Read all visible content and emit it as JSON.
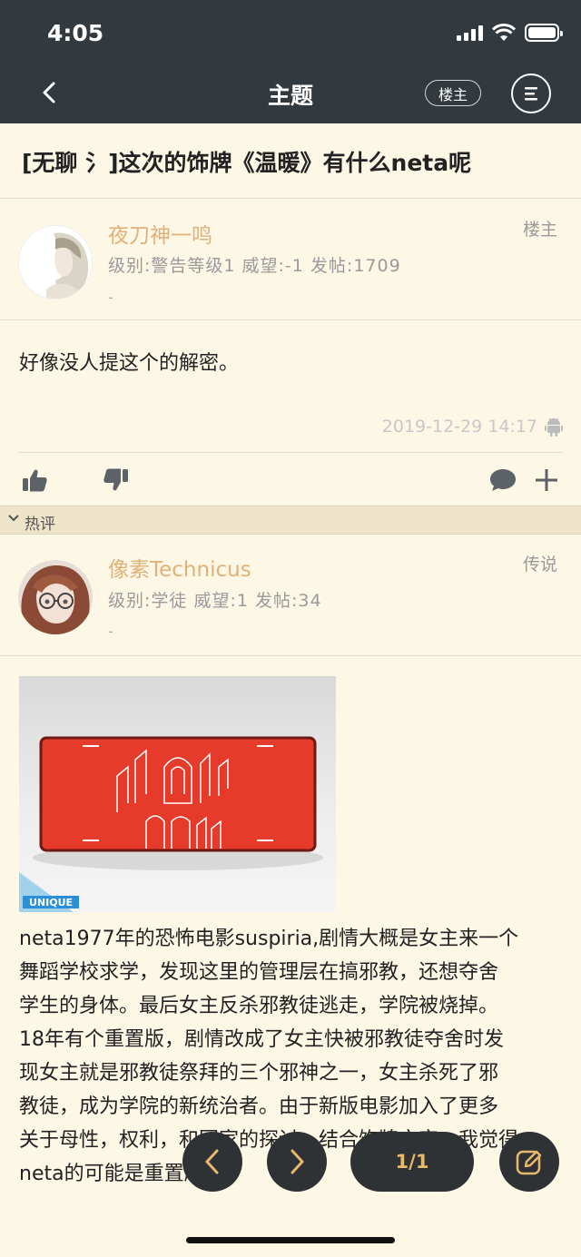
{
  "status_bar": {
    "time": "4:05"
  },
  "nav": {
    "title": "主题",
    "op_label": "楼主"
  },
  "thread": {
    "title": "[无聊 氵]这次的饰牌《温暖》有什么neta呢"
  },
  "op_post": {
    "user": {
      "name": "夜刀神一鸣",
      "level": "级别:警告等级1  威望:-1  发帖:1709",
      "dash": "-",
      "badge": "楼主"
    },
    "body": "好像没人提这个的解密。",
    "time": "2019-12-29 14:17"
  },
  "hot_section": {
    "label": "热评"
  },
  "reply": {
    "user": {
      "name": "像素Technicus",
      "level": "级别:学徒  威望:1  发帖:34",
      "dash": "-",
      "badge": "传说"
    },
    "image_watermark": "UNIQUE",
    "body_lines": [
      "neta1977年的恐怖电影suspiria,剧情大概是女主来一个",
      "舞蹈学校求学，发现这里的管理层在搞邪教，还想夺舍",
      "学生的身体。最后女主反杀邪教徒逃走，学院被烧掉。",
      "18年有个重置版，剧情改成了女主快被邪教徒夺舍时发",
      "现女主就是邪教徒祭拜的三个邪神之一，女主杀死了邪",
      "教徒，成为学院的新统治者。由于新版电影加入了更多",
      "关于母性，权利，和国家的探讨，结合饰牌文字，我觉得",
      "neta的可能是重置版"
    ]
  },
  "pager": {
    "label": "1/1"
  },
  "colors": {
    "header_bg": "#323a3f",
    "page_bg": "#fdf7e6",
    "username": "#e0b27a",
    "accent": "#e8b86b"
  },
  "icons": [
    "back-arrow-icon",
    "menu-lines-icon",
    "thumbs-up-icon",
    "thumbs-down-icon",
    "comment-icon",
    "plus-icon",
    "android-icon",
    "chevron-down-icon",
    "prev-icon",
    "next-icon",
    "edit-icon"
  ]
}
